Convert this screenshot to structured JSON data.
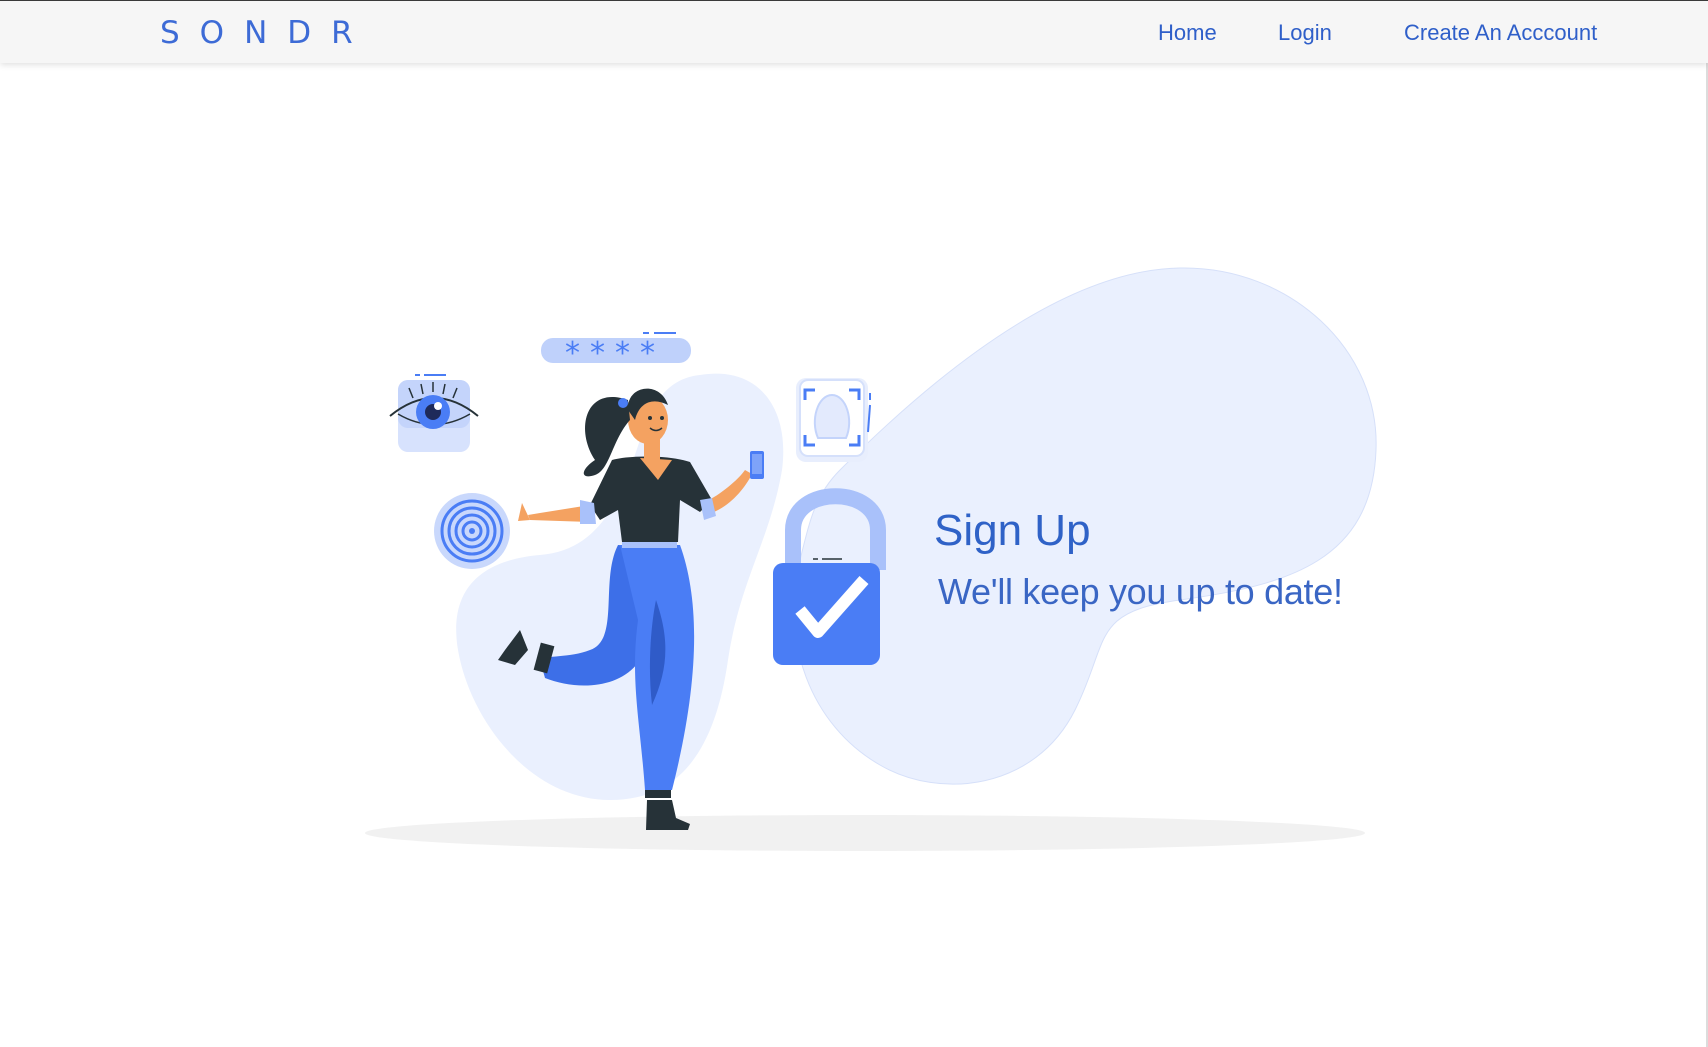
{
  "header": {
    "brand": "SONDR",
    "nav": {
      "home": "Home",
      "login": "Login",
      "create_account": "Create An Acccount"
    }
  },
  "hero": {
    "title": "Sign Up",
    "subtitle": "We'll keep you up to date!",
    "illustration": {
      "icons": [
        "eye-scan-icon",
        "password-field-icon",
        "face-id-icon",
        "fingerprint-icon",
        "padlock-check-icon",
        "phone-icon"
      ],
      "password_mask": "* * * *"
    }
  },
  "colors": {
    "brand": "#3d6bd6",
    "nav_link": "#2f5fc9",
    "accent_blue": "#4a7df5",
    "light_blue": "#eaf0fe",
    "navbar_bg": "#f6f6f6"
  }
}
